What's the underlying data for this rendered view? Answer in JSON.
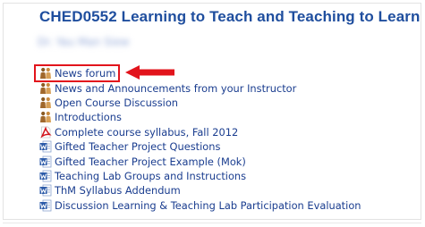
{
  "course": {
    "title": "CHED0552 Learning to Teach and Teaching to Learn",
    "instructor": "Dr. Yau Man Siew"
  },
  "resources": [
    {
      "label": "News forum",
      "icon": "forum-icon"
    },
    {
      "label": "News and Announcements from your Instructor",
      "icon": "forum-icon"
    },
    {
      "label": "Open Course Discussion",
      "icon": "forum-icon"
    },
    {
      "label": "Introductions",
      "icon": "forum-icon"
    },
    {
      "label": "Complete course syllabus, Fall 2012",
      "icon": "pdf-icon"
    },
    {
      "label": "Gifted Teacher Project Questions",
      "icon": "word-doc-icon"
    },
    {
      "label": "Gifted Teacher Project Example (Mok)",
      "icon": "word-doc-icon"
    },
    {
      "label": "Teaching Lab Groups and Instructions",
      "icon": "word-doc-icon"
    },
    {
      "label": "ThM Syllabus Addendum",
      "icon": "word-doc-icon"
    },
    {
      "label": "Discussion Learning & Teaching Lab Participation Evaluation",
      "icon": "word-doc-icon"
    }
  ],
  "annotation": {
    "highlight_color": "#e2141c",
    "target": "News forum"
  },
  "colors": {
    "title": "#1f4e9e",
    "link": "#1a3d8f"
  }
}
